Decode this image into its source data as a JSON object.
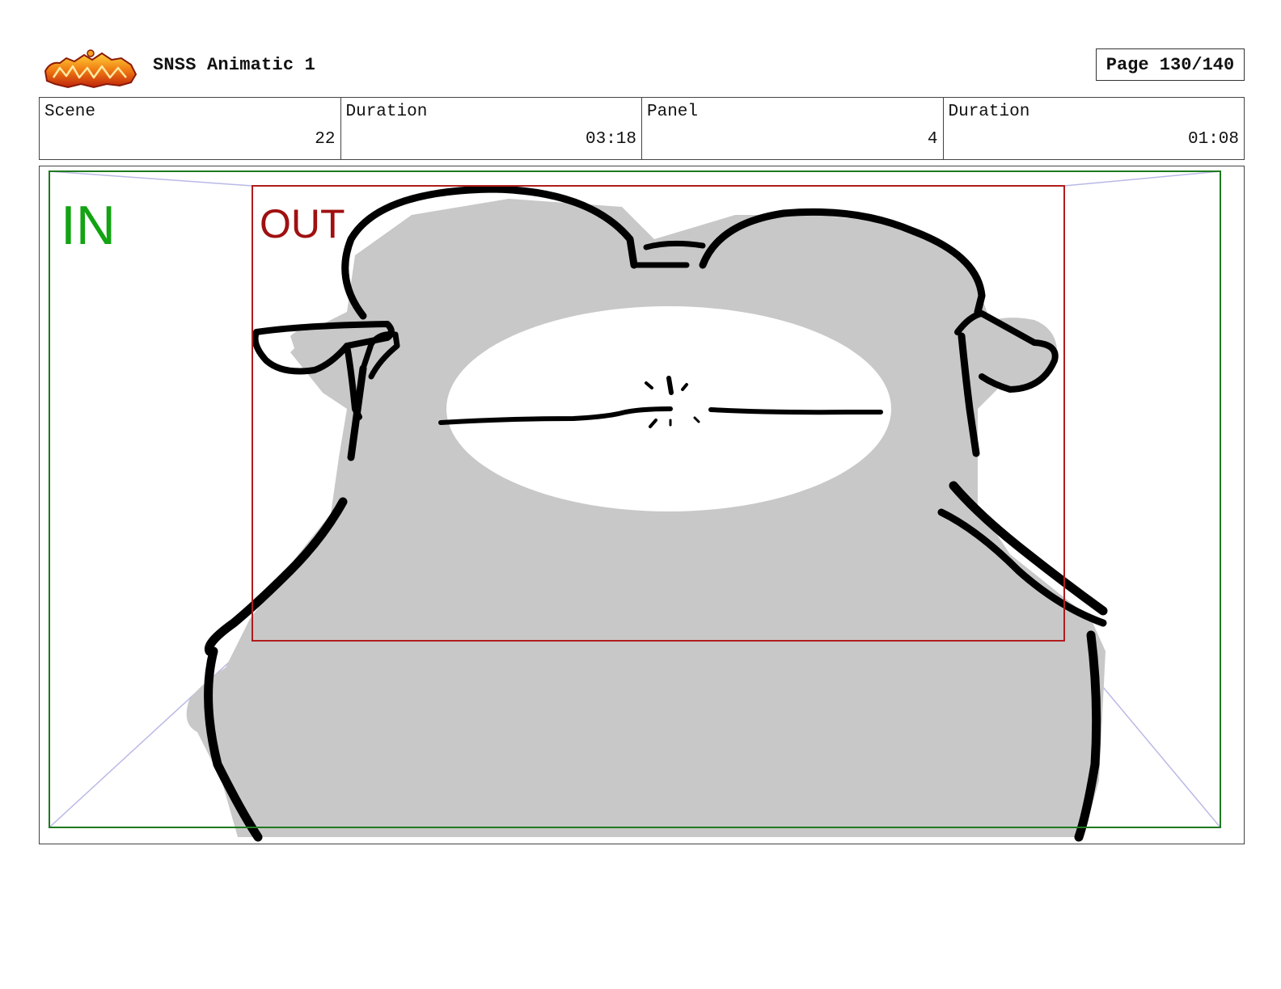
{
  "header": {
    "logo_icon": "show-logo-icon",
    "title": "SNSS Animatic 1",
    "page_label": "Page 130/140"
  },
  "info": {
    "scene_label": "Scene",
    "scene_value": "22",
    "scene_duration_label": "Duration",
    "scene_duration_value": "03:18",
    "panel_label": "Panel",
    "panel_value": "4",
    "panel_duration_label": "Duration",
    "panel_duration_value": "01:08"
  },
  "panel": {
    "in_label": "IN",
    "out_label": "OUT",
    "colors": {
      "in_frame": "#1f7a1f",
      "in_text": "#13a313",
      "out_frame": "#b01c1c",
      "out_text": "#a01010",
      "fill_gray": "#c8c8c8",
      "guide_lines": "#b9b9e6"
    }
  }
}
